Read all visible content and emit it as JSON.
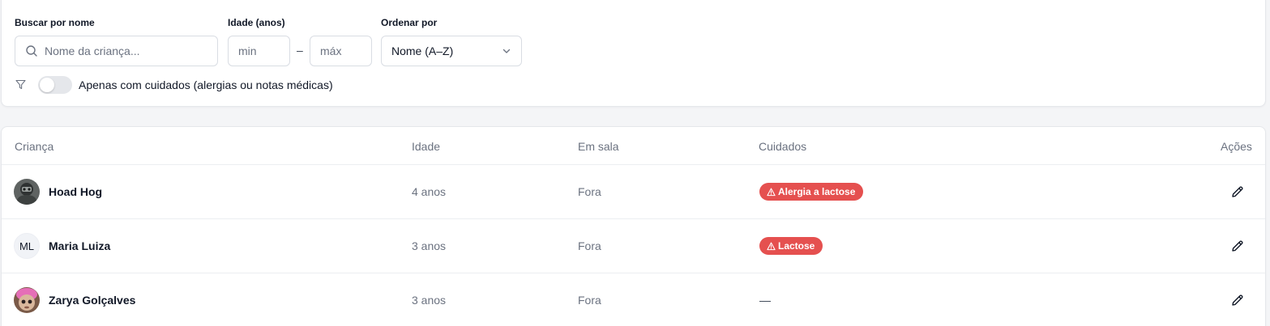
{
  "filters": {
    "search": {
      "label": "Buscar por nome",
      "placeholder": "Nome da criança..."
    },
    "age": {
      "label": "Idade (anos)",
      "min_placeholder": "min",
      "max_placeholder": "máx",
      "separator": "–"
    },
    "sort": {
      "label": "Ordenar por",
      "value": "Nome (A–Z)"
    },
    "care_toggle": {
      "label": "Apenas com cuidados (alergias ou notas médicas)",
      "enabled": false
    }
  },
  "table": {
    "columns": [
      "Criança",
      "Idade",
      "Em sala",
      "Cuidados",
      "Ações"
    ],
    "rows": [
      {
        "name": "Hoad Hog",
        "avatar": "photo",
        "age": "4 anos",
        "room": "Fora",
        "care": "Alergia a lactose"
      },
      {
        "name": "Maria Luiza",
        "avatar_initials": "ML",
        "age": "3 anos",
        "room": "Fora",
        "care": "Lactose"
      },
      {
        "name": "Zarya Golçalves",
        "avatar": "photo",
        "age": "3 anos",
        "room": "Fora",
        "care": "—"
      }
    ]
  },
  "colors": {
    "badge_red": "#e5504f",
    "muted_text": "#6b7280",
    "border": "#e5e7eb"
  },
  "icons": [
    "search-icon",
    "chevron-down-icon",
    "filter-icon",
    "warning-icon",
    "pencil-icon"
  ]
}
